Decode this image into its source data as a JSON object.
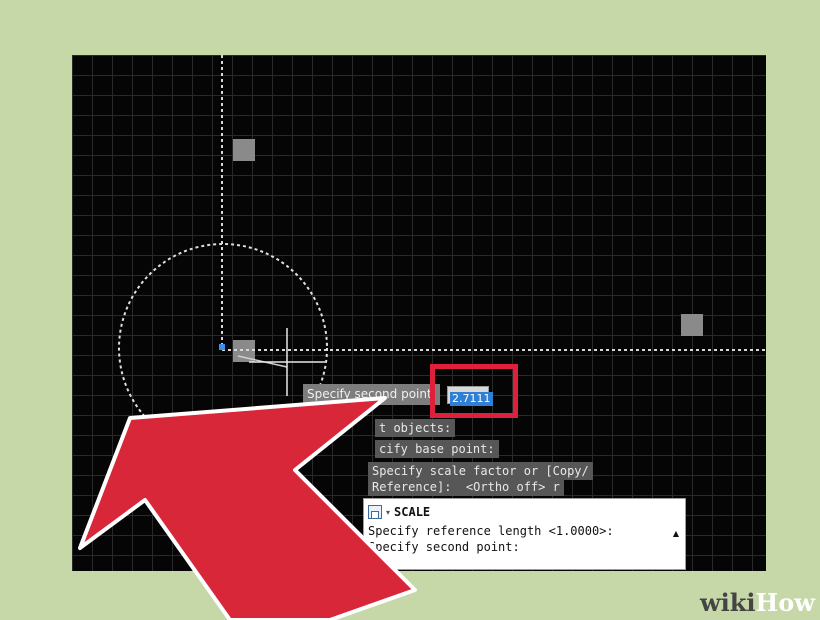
{
  "canvas": {
    "tooltip_label": "Specify second point:",
    "input_value": "2.7111"
  },
  "history": {
    "line1": "t objects:",
    "line2": "cify base point:",
    "line3": "Specify scale factor or [Copy/",
    "line4": "Reference]:  <Ortho off> r"
  },
  "command_bar": {
    "command_name": "SCALE",
    "line1": "Specify reference length <1.0000>:",
    "line2": "Specify second point:"
  },
  "toolbar": {
    "close_glyph": "✕",
    "customize_glyph": "🔧"
  },
  "watermark": {
    "part1": "wiki",
    "part2": "How"
  },
  "colors": {
    "background": "#c6d7a8",
    "canvas": "#050505",
    "highlight": "#e0203a",
    "arrow": "#d9273a"
  }
}
